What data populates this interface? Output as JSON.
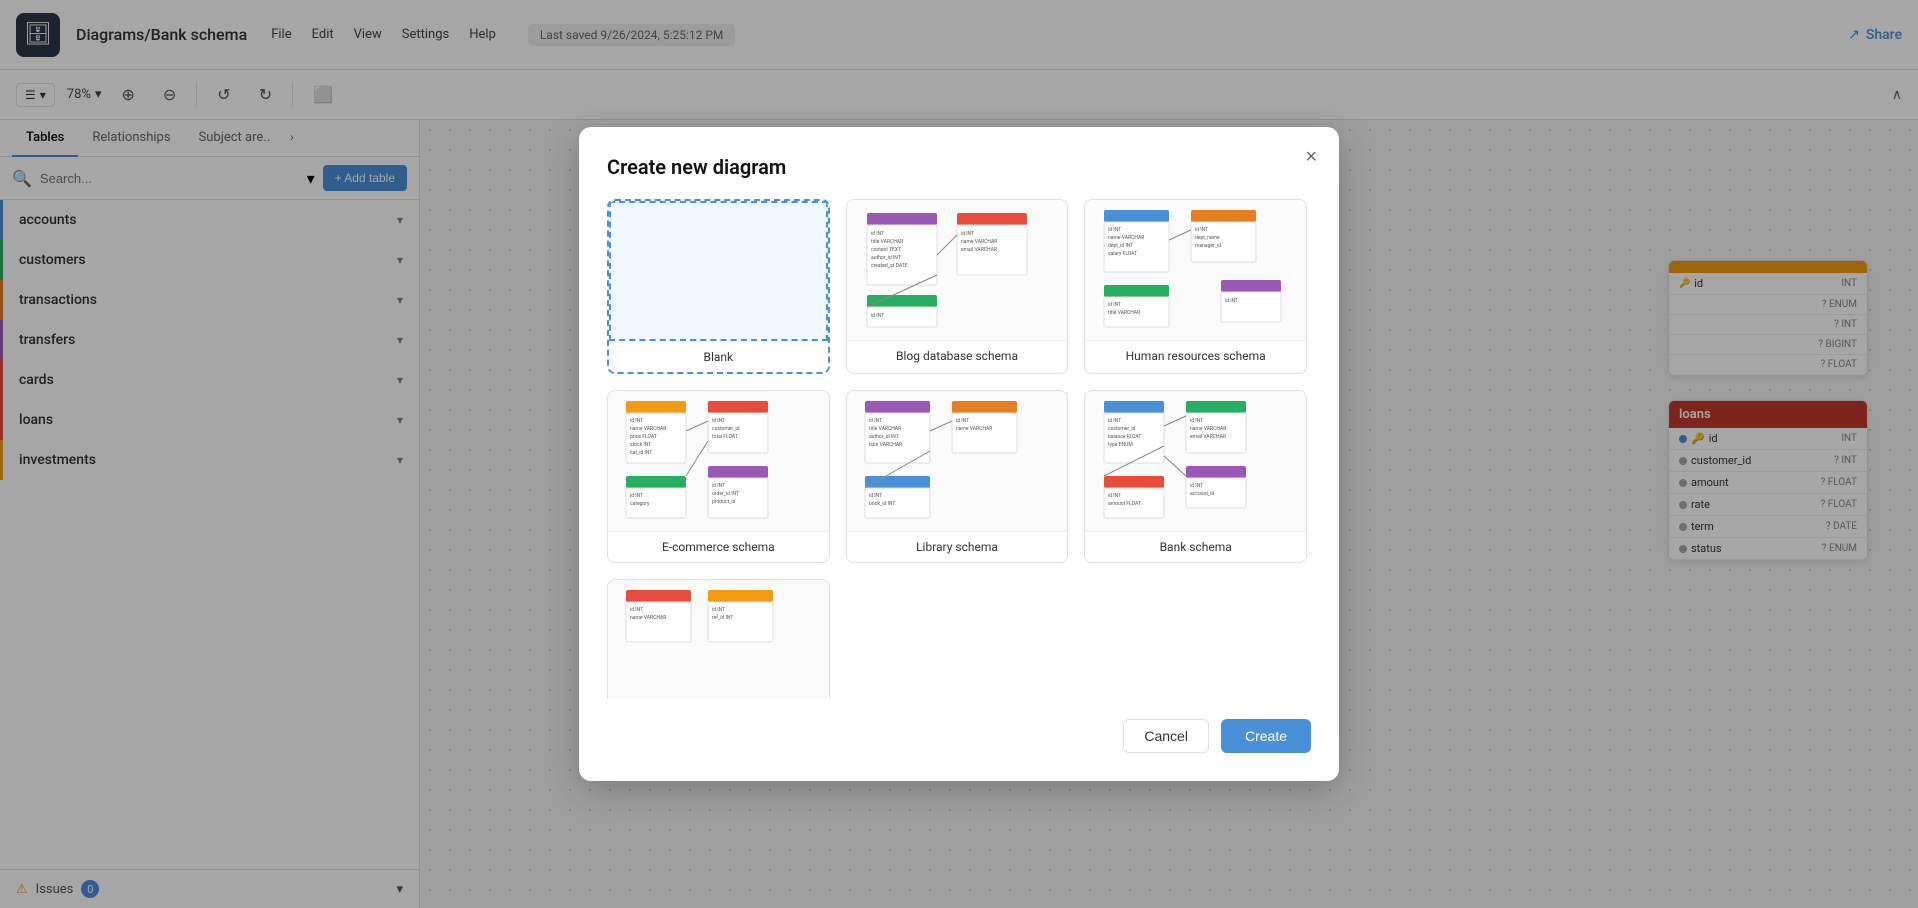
{
  "app": {
    "logo": "🗄",
    "title": "Diagrams/Bank schema",
    "last_saved": "Last saved 9/26/2024, 5:25:12 PM",
    "share_label": "Share"
  },
  "toolbar": {
    "zoom": "78%",
    "layout_icon": "☰",
    "zoom_in_icon": "⊕",
    "zoom_out_icon": "⊖",
    "undo_icon": "↺",
    "redo_icon": "↻",
    "page_icon": "⬜"
  },
  "sidebar": {
    "tabs": [
      {
        "label": "Tables",
        "active": true
      },
      {
        "label": "Relationships",
        "active": false
      },
      {
        "label": "Subject are..",
        "active": false
      }
    ],
    "search_placeholder": "Search...",
    "add_table_label": "+ Add table",
    "tables": [
      {
        "name": "accounts",
        "color": "t-accounts"
      },
      {
        "name": "customers",
        "color": "t-customers"
      },
      {
        "name": "transactions",
        "color": "t-transactions"
      },
      {
        "name": "transfers",
        "color": "t-transfers"
      },
      {
        "name": "cards",
        "color": "t-cards"
      },
      {
        "name": "loans",
        "color": "t-loans"
      },
      {
        "name": "investments",
        "color": "t-investments"
      }
    ],
    "issues_label": "Issues",
    "issues_count": "0"
  },
  "modal": {
    "title": "Create new diagram",
    "close_icon": "×",
    "diagrams": [
      {
        "id": "blank",
        "label": "Blank",
        "selected": true,
        "type": "blank"
      },
      {
        "id": "blog",
        "label": "Blog database schema",
        "selected": false,
        "type": "multi"
      },
      {
        "id": "hr",
        "label": "Human resources schema",
        "selected": false,
        "type": "multi"
      },
      {
        "id": "ecommerce",
        "label": "E-commerce schema",
        "selected": false,
        "type": "multi"
      },
      {
        "id": "library",
        "label": "Library schema",
        "selected": false,
        "type": "multi"
      },
      {
        "id": "bank",
        "label": "Bank schema",
        "selected": false,
        "type": "multi"
      },
      {
        "id": "more",
        "label": "",
        "selected": false,
        "type": "partial"
      }
    ],
    "cancel_label": "Cancel",
    "create_label": "Create"
  },
  "loans_card": {
    "title": "loans",
    "fields": [
      {
        "name": "id",
        "type": "INT",
        "key": true
      },
      {
        "name": "customer_id",
        "type": "? INT",
        "key": false
      },
      {
        "name": "amount",
        "type": "? FLOAT",
        "key": false
      },
      {
        "name": "rate",
        "type": "? FLOAT",
        "key": false
      },
      {
        "name": "term",
        "type": "? DATE",
        "key": false
      },
      {
        "name": "status",
        "type": "? ENUM",
        "key": false
      }
    ]
  },
  "accounts_card": {
    "fields": [
      {
        "type": "INT"
      },
      {
        "type": "? ENUM"
      },
      {
        "type": "? INT"
      },
      {
        "type": "? BIGINT"
      },
      {
        "type": "? FLOAT"
      }
    ]
  }
}
